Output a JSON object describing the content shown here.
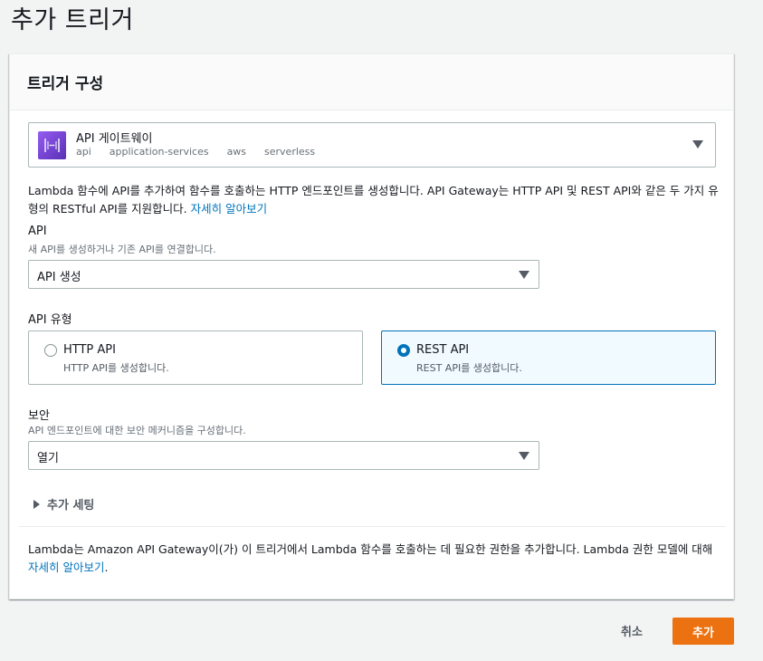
{
  "page": {
    "title": "추가 트리거"
  },
  "panel": {
    "title": "트리거 구성"
  },
  "trigger": {
    "name": "API 게이트웨이",
    "tags": [
      "api",
      "application-services",
      "aws",
      "serverless"
    ],
    "icon": "api-gateway-icon",
    "icon_color": "#7b4ae0"
  },
  "intro": {
    "text": "Lambda 함수에 API를 추가하여 함수를 호출하는 HTTP 엔드포인트를 생성합니다. API Gateway는 HTTP API 및 REST API와 같은 두 가지 유형의 RESTful API를 지원합니다. ",
    "link": "자세히 알아보기"
  },
  "api": {
    "label": "API",
    "description": "새 API를 생성하거나 기존 API를 연결합니다.",
    "value": "API 생성"
  },
  "api_type": {
    "label": "API 유형",
    "options": [
      {
        "title": "HTTP API",
        "description": "HTTP API를 생성합니다.",
        "selected": false
      },
      {
        "title": "REST API",
        "description": "REST API를 생성합니다.",
        "selected": true
      }
    ]
  },
  "security": {
    "label": "보안",
    "description": "API 엔드포인트에 대한 보안 메커니즘을 구성합니다.",
    "value": "열기"
  },
  "additional": {
    "label": "추가 세팅"
  },
  "footer_note": {
    "text": "Lambda는 Amazon API Gateway이(가) 이 트리거에서 Lambda 함수를 호출하는 데 필요한 권한을 추가합니다. Lambda 권한 모델에 대해 ",
    "link": "자세히 알아보기",
    "suffix": "."
  },
  "actions": {
    "cancel": "취소",
    "add": "추가"
  },
  "colors": {
    "accent": "#0073bb",
    "primary_button": "#ec7211"
  }
}
